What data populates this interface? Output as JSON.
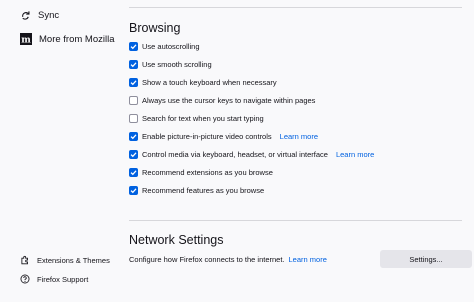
{
  "sidebar": {
    "sync_label": "Sync",
    "more_from_mozilla_label": "More from Mozilla",
    "extensions_themes_label": "Extensions & Themes",
    "firefox_support_label": "Firefox Support"
  },
  "browsing": {
    "title": "Browsing",
    "learn_more": "Learn more",
    "options": [
      {
        "label": "Use autoscrolling",
        "checked": true
      },
      {
        "label": "Use smooth scrolling",
        "checked": true
      },
      {
        "label": "Show a touch keyboard when necessary",
        "checked": true
      },
      {
        "label": "Always use the cursor keys to navigate within pages",
        "checked": false
      },
      {
        "label": "Search for text when you start typing",
        "checked": false
      },
      {
        "label": "Enable picture-in-picture video controls",
        "checked": true
      },
      {
        "label": "Control media via keyboard, headset, or virtual interface",
        "checked": true
      },
      {
        "label": "Recommend extensions as you browse",
        "checked": true
      },
      {
        "label": "Recommend features as you browse",
        "checked": true
      }
    ]
  },
  "network": {
    "title": "Network Settings",
    "description": "Configure how Firefox connects to the internet.",
    "learn_more": "Learn more",
    "settings_button": "Settings..."
  },
  "colors": {
    "accent": "#0061e0",
    "background": "#f9f9fb"
  }
}
